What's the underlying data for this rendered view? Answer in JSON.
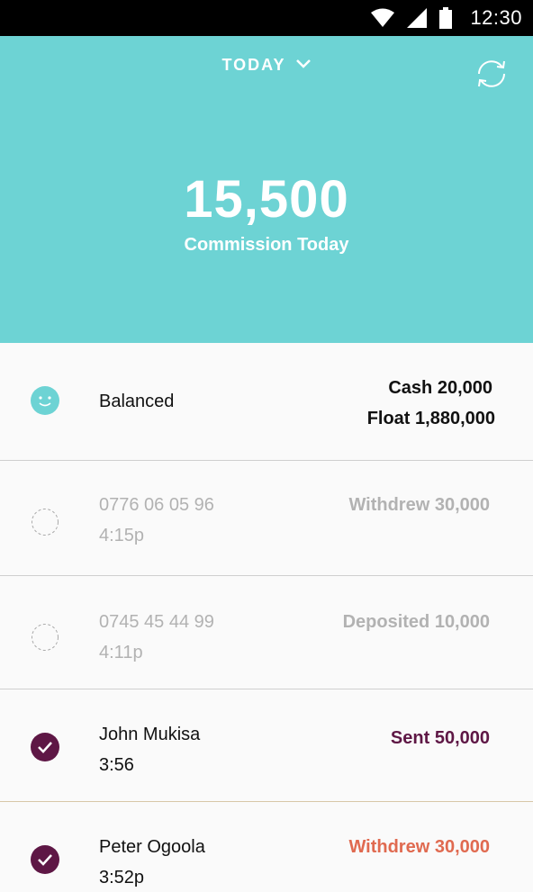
{
  "status_bar": {
    "time": "12:30",
    "icons": [
      "wifi-icon",
      "cellular-signal-icon",
      "battery-icon"
    ]
  },
  "header": {
    "period": "TODAY",
    "commission_amount": "15,500",
    "commission_label": "Commission Today",
    "background_color": "#6dd3d4"
  },
  "balance": {
    "status": "Balanced",
    "cash": "Cash 20,000",
    "float": "Float 1,880,000"
  },
  "transactions": [
    {
      "name": "0776 06 05 96",
      "time": "4:15p",
      "action": "Withdrew 30,000",
      "state": "pending"
    },
    {
      "name": "0745 45 44 99",
      "time": "4:11p",
      "action": "Deposited 10,000",
      "state": "pending"
    },
    {
      "name": "John Mukisa",
      "time": "3:56",
      "action": "Sent 50,000",
      "state": "confirmed"
    },
    {
      "name": "Peter Ogoola",
      "time": "3:52p",
      "action": "Withdrew 30,000",
      "state": "confirmed"
    }
  ],
  "colors": {
    "accent": "#6dd3d4",
    "confirmed": "#5e1745",
    "withdraw": "#e06a50",
    "muted": "#b2b2b2"
  }
}
